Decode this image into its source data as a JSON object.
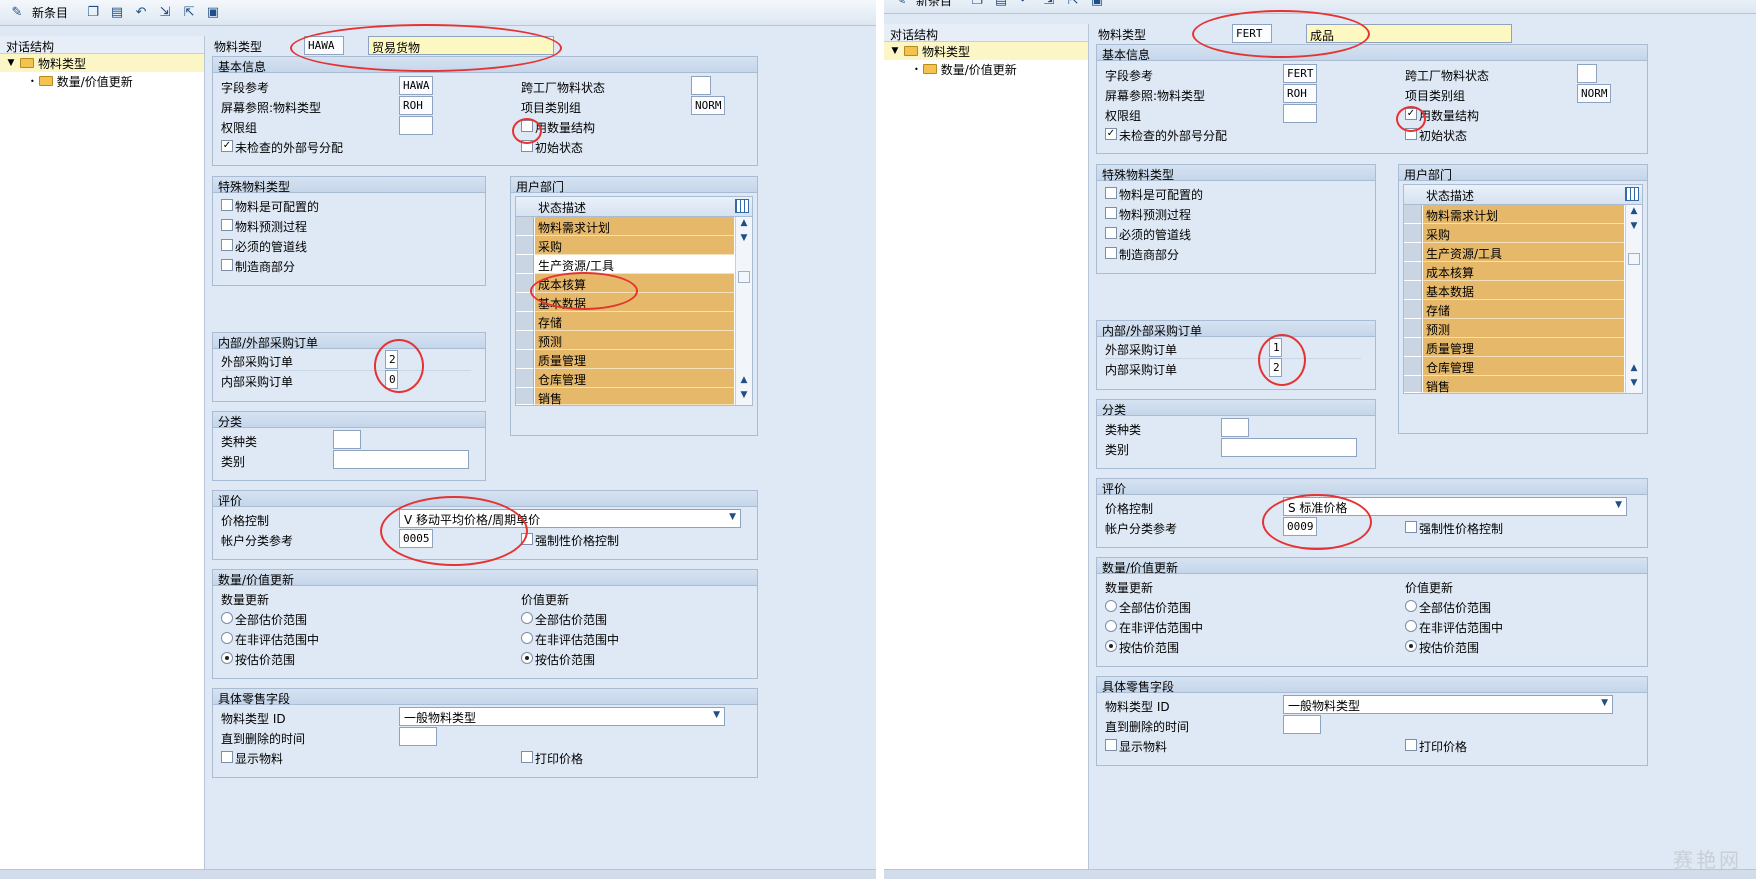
{
  "toolbar": {
    "new_entries": "新条目"
  },
  "tree": {
    "header": "对话结构",
    "root": "物料类型",
    "child": "数量/价值更新"
  },
  "labels": {
    "material_type": "物料类型",
    "basic_info": "基本信息",
    "field_ref": "字段参考",
    "screen_ref": "屏幕参照:物料类型",
    "auth_group": "权限组",
    "unchecked_ext": "未检查的外部号分配",
    "xplant_status": "跨工厂物料状态",
    "item_cat_group": "项目类别组",
    "qty_structure": "用数量结构",
    "initial_status": "初始状态",
    "special_type": "特殊物料类型",
    "configurable": "物料是可配置的",
    "forecast": "物料预测过程",
    "pipeline": "必须的管道线",
    "mpn": "制造商部分",
    "user_dept": "用户部门",
    "status_desc": "状态描述",
    "purchase_orders": "内部/外部采购订单",
    "ext_po": "外部采购订单",
    "int_po": "内部采购订单",
    "classification": "分类",
    "class_type": "类种类",
    "class": "类别",
    "valuation": "评价",
    "price_control": "价格控制",
    "acct_cat_ref": "帐户分类参考",
    "mandatory_price": "强制性价格控制",
    "qty_value_update": "数量/价值更新",
    "qty_update": "数量更新",
    "value_update": "价值更新",
    "all_val_areas": "全部估价范围",
    "not_in_val": "在非评估范围中",
    "by_val_area": "按估价范围",
    "retail_fields": "具体零售字段",
    "mat_type_id": "物料类型 ID",
    "time_until_delete": "直到删除的时间",
    "display_material": "显示物料",
    "print_price": "打印价格"
  },
  "user_depts": [
    "物料需求计划",
    "采购",
    "生产资源/工具",
    "成本核算",
    "基本数据",
    "存储",
    "预测",
    "质量管理",
    "仓库管理",
    "销售"
  ],
  "left": {
    "code": "HAWA",
    "desc": "贸易货物",
    "field_ref": "HAWA",
    "screen_ref": "ROH",
    "item_cat_group": "NORM",
    "ext_po": "2",
    "int_po": "0",
    "price_control": "V 移动平均价格/周期单价",
    "acct_cat_ref": "0005",
    "mat_type_id": "一般物料类型"
  },
  "right": {
    "code": "FERT",
    "desc": "成品",
    "field_ref": "FERT",
    "screen_ref": "ROH",
    "item_cat_group": "NORM",
    "ext_po": "1",
    "int_po": "2",
    "price_control": "S 标准价格",
    "acct_cat_ref": "0009",
    "mat_type_id": "一般物料类型"
  },
  "watermark": "赛艳网",
  "colors": {
    "highlight_circle": "#e53333",
    "table_row": "#e6b96a",
    "required_field": "#fdf7c2"
  }
}
